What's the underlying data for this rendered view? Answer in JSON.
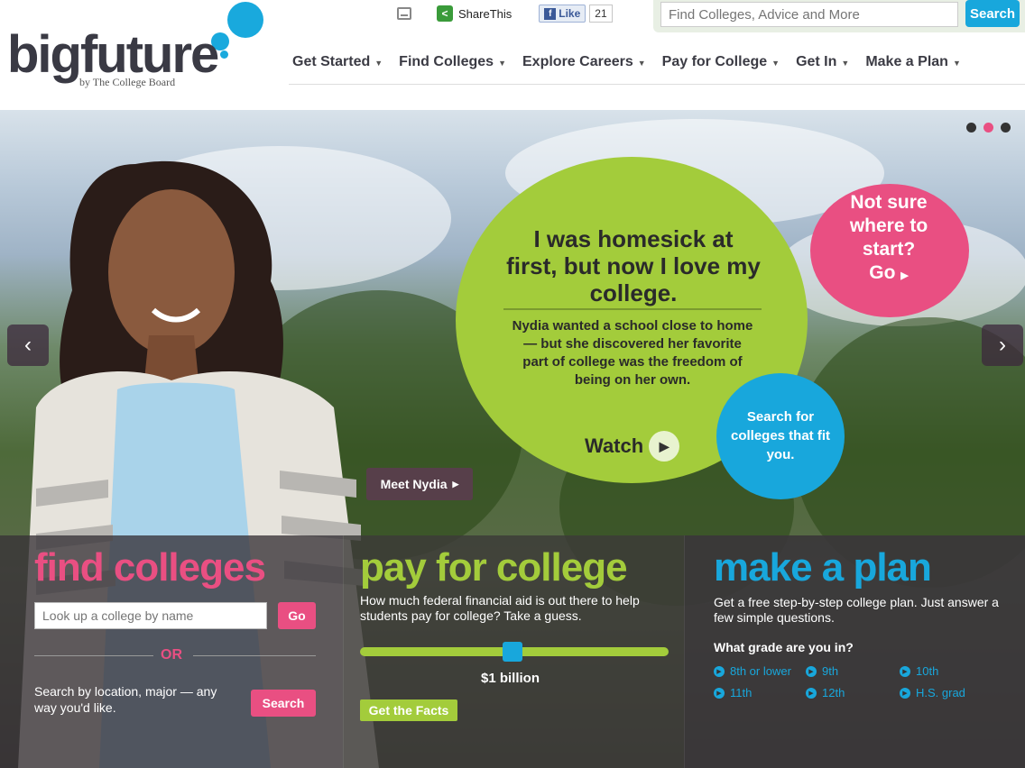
{
  "header": {
    "logo_text": "bigfuture",
    "logo_sub": "by The College Board",
    "share_label": "ShareThis",
    "like_label": "Like",
    "like_count": "21",
    "search_placeholder": "Find Colleges, Advice and More",
    "search_button": "Search"
  },
  "nav": {
    "items": [
      {
        "label": "Get Started"
      },
      {
        "label": "Find Colleges"
      },
      {
        "label": "Explore Careers"
      },
      {
        "label": "Pay for College"
      },
      {
        "label": "Get In"
      },
      {
        "label": "Make a Plan"
      }
    ]
  },
  "hero": {
    "quote": "I was homesick at first, but now I love my college.",
    "subquote": "Nydia wanted a school close to home — but she discovered her favorite part of college was the freedom of being on her own.",
    "watch_label": "Watch",
    "not_sure": "Not sure where to start?",
    "go_label": "Go",
    "search_circle": "Search for colleges that fit you.",
    "meet_button": "Meet Nydia",
    "slide_count": 3,
    "active_slide": 2
  },
  "find_colleges": {
    "title": "find colleges",
    "lookup_placeholder": "Look up a college by name",
    "go_button": "Go",
    "or_text": "OR",
    "location_text": "Search by location, major — any way you'd like.",
    "search_button": "Search",
    "color": "#e94f82"
  },
  "pay_for_college": {
    "title": "pay for college",
    "text": "How much federal financial aid is out there to help students pay for college? Take a guess.",
    "slider_value": "$1 billion",
    "facts_button": "Get the Facts",
    "color": "#a3cc3b"
  },
  "make_a_plan": {
    "title": "make a plan",
    "text": "Get a free step-by-step college plan. Just answer a few simple questions.",
    "grade_question": "What grade are you in?",
    "grades": [
      "8th or lower",
      "9th",
      "10th",
      "11th",
      "12th",
      "H.S. grad"
    ],
    "color": "#18a7dc"
  }
}
